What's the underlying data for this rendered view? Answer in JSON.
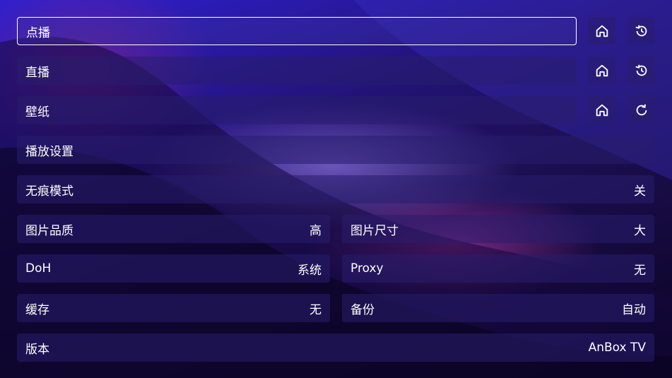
{
  "rows": {
    "vod": {
      "label": "点播"
    },
    "live": {
      "label": "直播"
    },
    "wallpaper": {
      "label": "壁纸"
    },
    "player_settings": {
      "label": "播放设置"
    },
    "incognito": {
      "label": "无痕模式",
      "value": "关"
    },
    "image_quality": {
      "label": "图片品质",
      "value": "高"
    },
    "image_size": {
      "label": "图片尺寸",
      "value": "大"
    },
    "doh": {
      "label": "DoH",
      "value": "系统"
    },
    "proxy": {
      "label": "Proxy",
      "value": "无"
    },
    "cache": {
      "label": "缓存",
      "value": "无"
    },
    "backup": {
      "label": "备份",
      "value": "自动"
    },
    "version": {
      "label": "版本",
      "value": "AnBox TV"
    }
  },
  "icons": {
    "home": "home-icon",
    "history": "history-icon",
    "refresh": "refresh-icon"
  },
  "colors": {
    "text": "#ffffff",
    "focus_border": "#ffffff"
  }
}
